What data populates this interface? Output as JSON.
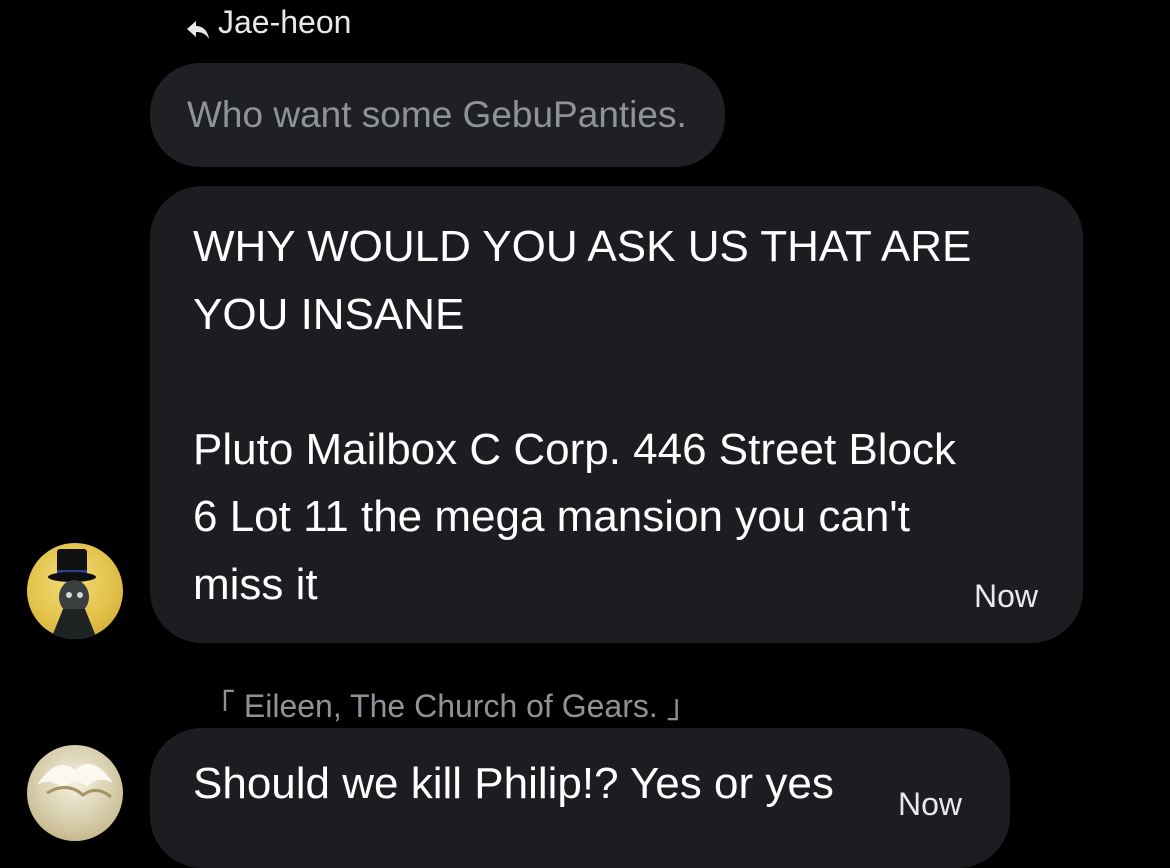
{
  "reply_header": {
    "name": "Jae-heon",
    "icon": "reply-arrow-icon"
  },
  "quoted_message": {
    "text": "Who want some GebuPanties."
  },
  "main_message": {
    "text": "WHY WOULD YOU ASK US THAT ARE\nYOU INSANE\n\nPluto Mailbox C Corp. 446 Street Block\n6 Lot 11 the mega mansion you can't\nmiss it",
    "timestamp": "Now",
    "avatar": "top-hat-avatar"
  },
  "next_message": {
    "sender": "「 Eileen, The Church of Gears. 」",
    "text": "Should we kill Philip!? Yes or yes",
    "timestamp": "Now",
    "avatar": "cream-avatar"
  },
  "colors": {
    "background": "#000000",
    "bubble": "#1c1d21",
    "quoted_bubble": "#1f2024",
    "muted_text": "#8f9397",
    "text": "#ffffff"
  }
}
